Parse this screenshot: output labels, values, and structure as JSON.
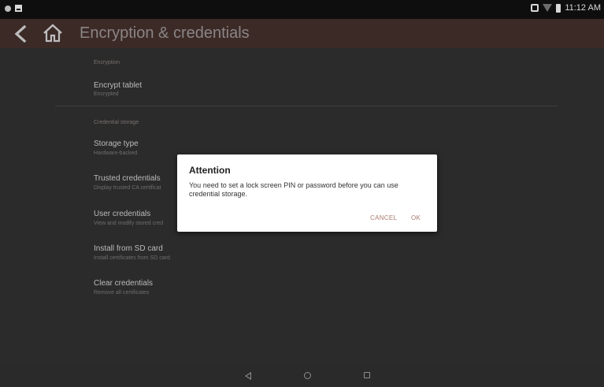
{
  "status_bar": {
    "time": "11:12 AM",
    "left_icons": [
      "notification-dot-icon",
      "image-notification-icon"
    ],
    "right_icons": [
      "vibrate-icon",
      "wifi-icon",
      "battery-icon"
    ]
  },
  "app_bar": {
    "title": "Encryption & credentials",
    "color": "#3c2a27"
  },
  "sections": {
    "encryption": {
      "header": "Encryption",
      "items": [
        {
          "title": "Encrypt tablet",
          "summary": "Encrypted"
        }
      ]
    },
    "credential_storage": {
      "header": "Credential storage",
      "items": [
        {
          "title": "Storage type",
          "summary": "Hardware-backed"
        },
        {
          "title": "Trusted credentials",
          "summary": "Display trusted CA certificat"
        },
        {
          "title": "User credentials",
          "summary": "View and modify stored cred"
        },
        {
          "title": "Install from SD card",
          "summary": "Install certificates from SD card"
        },
        {
          "title": "Clear credentials",
          "summary": "Remove all certificates"
        }
      ]
    }
  },
  "dialog": {
    "title": "Attention",
    "message": "You need to set a lock screen PIN or password before you can use credential storage.",
    "cancel_label": "CANCEL",
    "ok_label": "OK",
    "accent_color": "#a97a6e"
  },
  "nav_bar": {
    "icons": [
      "nav-back-icon",
      "nav-home-icon",
      "nav-recents-icon"
    ]
  }
}
